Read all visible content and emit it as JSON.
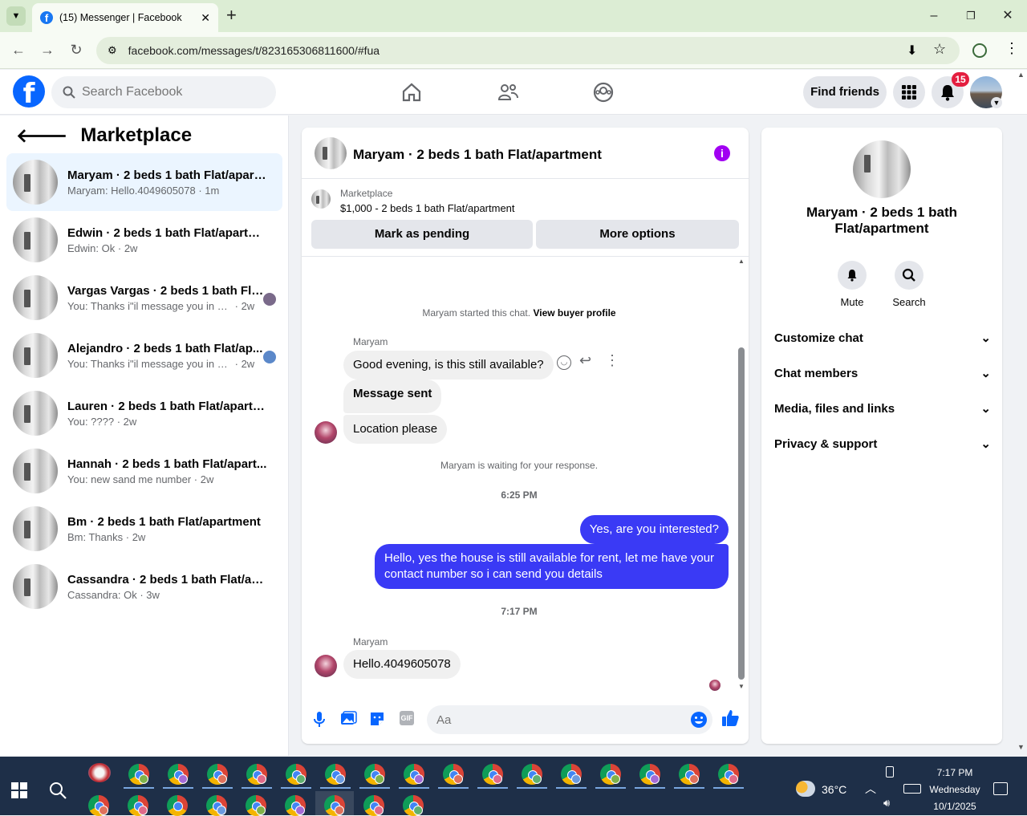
{
  "browser": {
    "tab_title": "(15) Messenger | Facebook",
    "url": "facebook.com/messages/t/823165306811600/#fua"
  },
  "header": {
    "search_placeholder": "Search Facebook",
    "find_friends": "Find friends",
    "notifications_count": "15"
  },
  "sidebar": {
    "title": "Marketplace",
    "conversations": [
      {
        "name": "Maryam · 2 beds 1 bath Flat/apart...",
        "preview": "Maryam: Hello.4049605078",
        "time": "1m",
        "active": true
      },
      {
        "name": "Edwin · 2 beds 1 bath Flat/apartme...",
        "preview": "Edwin: Ok",
        "time": "2w"
      },
      {
        "name": "Vargas Vargas · 2 beds 1 bath Fla...",
        "preview": "You: Thanks i\"il message you in a ...",
        "time": "2w"
      },
      {
        "name": "Alejandro · 2 beds 1 bath Flat/ap...",
        "preview": "You: Thanks i\"il message you in a ...",
        "time": "2w"
      },
      {
        "name": "Lauren · 2 beds 1 bath Flat/apartm...",
        "preview": "You: ????",
        "time": "2w"
      },
      {
        "name": "Hannah · 2 beds 1 bath Flat/apart...",
        "preview": "You: new sand me number",
        "time": "2w"
      },
      {
        "name": "Bm · 2 beds 1 bath Flat/apartment",
        "preview": "Bm: Thanks",
        "time": "2w"
      },
      {
        "name": "Cassandra · 2 beds 1 bath Flat/apa...",
        "preview": "Cassandra: Ok",
        "time": "3w"
      }
    ]
  },
  "chat": {
    "title": "Maryam · 2 beds 1 bath Flat/apartment",
    "marketplace_label": "Marketplace",
    "listing": "$1,000 - 2 beds 1 bath Flat/apartment",
    "mark_pending": "Mark as pending",
    "more_options": "More options",
    "started_text": "Maryam started this chat.",
    "view_profile": "View buyer profile",
    "sender1": "Maryam",
    "msg1": "Good evening, is this still available?",
    "msg2": "Message sent",
    "msg3": "Location please",
    "waiting": "Maryam is waiting for your response.",
    "time1": "6:25 PM",
    "out1": "Yes, are you interested?",
    "out2": "Hello, yes the house is still available for rent, let me have your contact number so i can send you details",
    "time2": "7:17 PM",
    "sender2": "Maryam",
    "msg4": "Hello.4049605078",
    "composer_placeholder": "Aa"
  },
  "details": {
    "name": "Maryam · 2 beds 1 bath Flat/apartment",
    "mute": "Mute",
    "search": "Search",
    "sections": [
      "Customize chat",
      "Chat members",
      "Media, files and links",
      "Privacy & support"
    ]
  },
  "taskbar": {
    "temp": "36°C",
    "time": "7:17 PM",
    "day": "Wednesday",
    "date": "10/1/2025"
  }
}
